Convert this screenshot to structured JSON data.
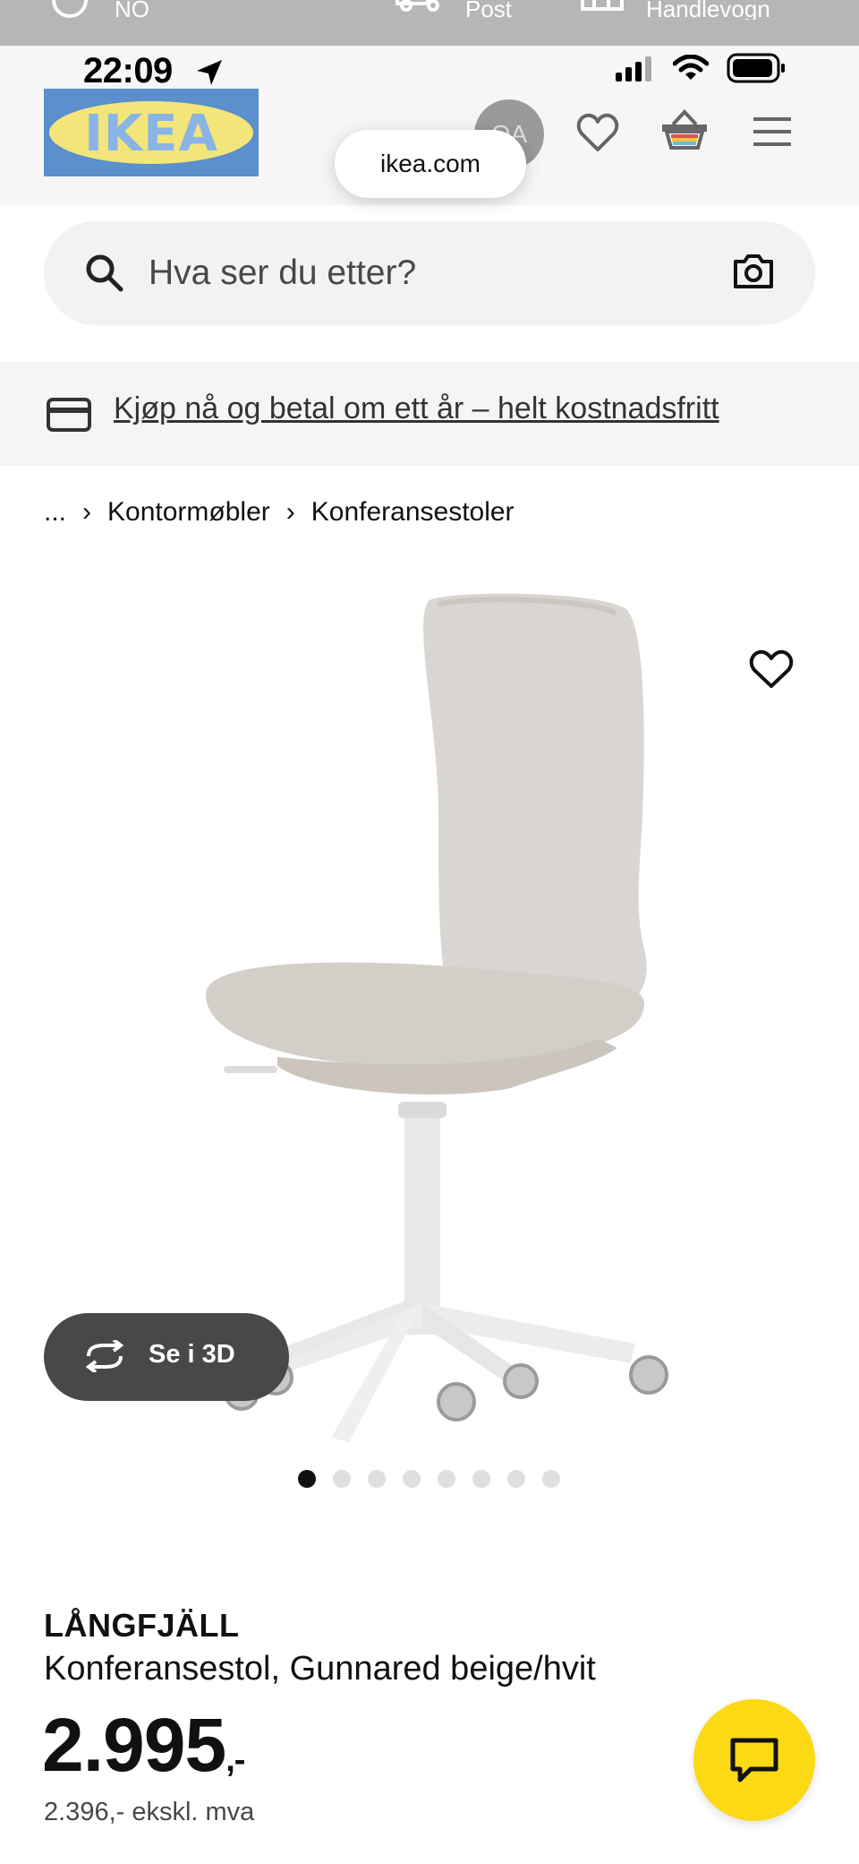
{
  "top_strip": {
    "items": [
      "NO",
      "Post",
      "Handlevogn"
    ]
  },
  "status_bar": {
    "time": "22:09",
    "icons": [
      "location-arrow-icon",
      "signal-icon",
      "wifi-icon",
      "battery-icon"
    ]
  },
  "header": {
    "logo_text": "IKEA",
    "avatar_initials": "OA",
    "icons": [
      "heart-icon",
      "basket-icon",
      "menu-icon"
    ],
    "url": "ikea.com"
  },
  "search": {
    "placeholder": "Hva ser du etter?",
    "icons": [
      "search-icon",
      "camera-icon"
    ]
  },
  "promo": {
    "text": "Kjøp nå og betal om ett år – helt kostnadsfritt",
    "icon": "credit-card-icon"
  },
  "breadcrumb": {
    "items": [
      "...",
      "Kontormøbler",
      "Konferansestoler"
    ]
  },
  "gallery": {
    "button_3d": "Se i 3D",
    "image_count": 8,
    "active_index": 1
  },
  "product": {
    "name": "LÅNGFJÄLL",
    "description": "Konferansestol, Gunnared beige/hvit",
    "price_main": "2.995",
    "price_suffix": ",-",
    "price_ex_vat": "2.396,- ekskl. mva"
  },
  "colors": {
    "ikea_blue": "#0058a3",
    "ikea_yellow": "#fbd914",
    "pill_dark": "#484848"
  }
}
